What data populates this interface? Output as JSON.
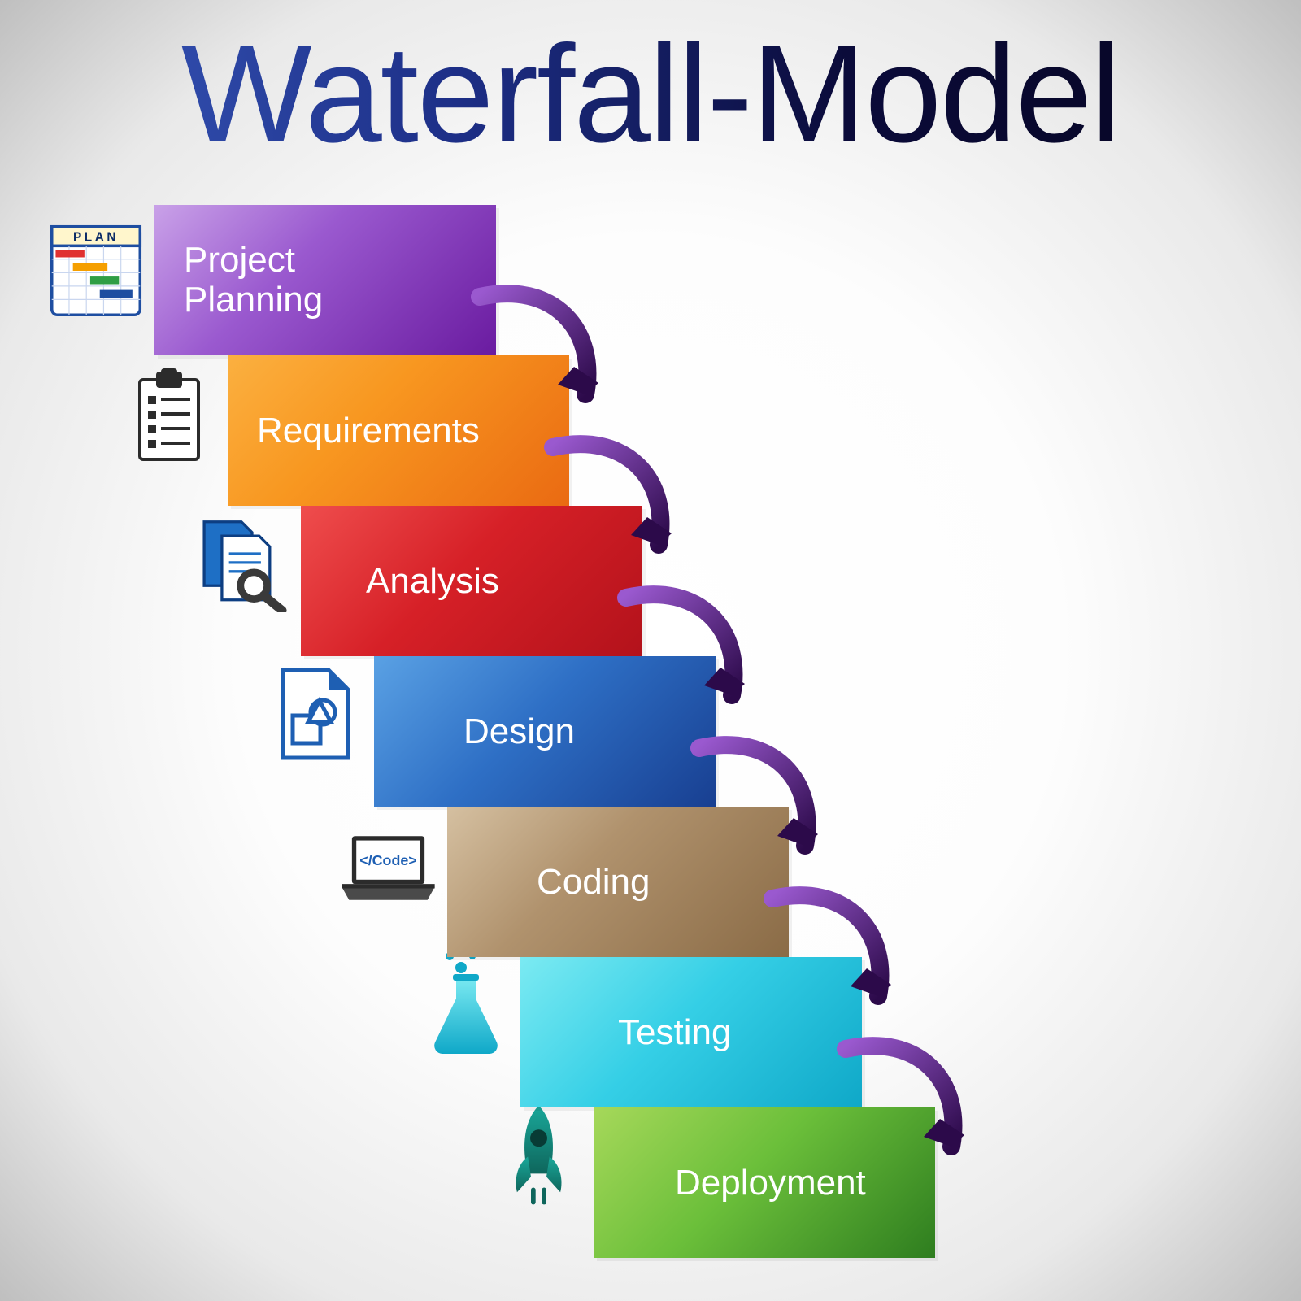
{
  "title": "Waterfall-Model",
  "steps": [
    {
      "label": "Project\nPlanning",
      "icon": "gantt-chart-icon",
      "color": "purple"
    },
    {
      "label": "Requirements",
      "icon": "clipboard-icon",
      "color": "orange"
    },
    {
      "label": "Analysis",
      "icon": "search-docs-icon",
      "color": "red"
    },
    {
      "label": "Design",
      "icon": "blueprint-icon",
      "color": "blue"
    },
    {
      "label": "Coding",
      "icon": "laptop-code-icon",
      "color": "brown"
    },
    {
      "label": "Testing",
      "icon": "flask-icon",
      "color": "cyan"
    },
    {
      "label": "Deployment",
      "icon": "rocket-icon",
      "color": "green"
    }
  ],
  "icon_labels": {
    "gantt-chart-icon": "PLAN",
    "laptop-code-icon": "</Code>"
  },
  "colors": {
    "purple": "#6a1ba0",
    "orange": "#ea6a12",
    "red": "#b3121b",
    "blue": "#183f91",
    "brown": "#8a6b46",
    "cyan": "#0fa8c8",
    "green": "#2e7d1f",
    "arrow_start": "#9a59cf",
    "arrow_end": "#2c0a4a"
  }
}
